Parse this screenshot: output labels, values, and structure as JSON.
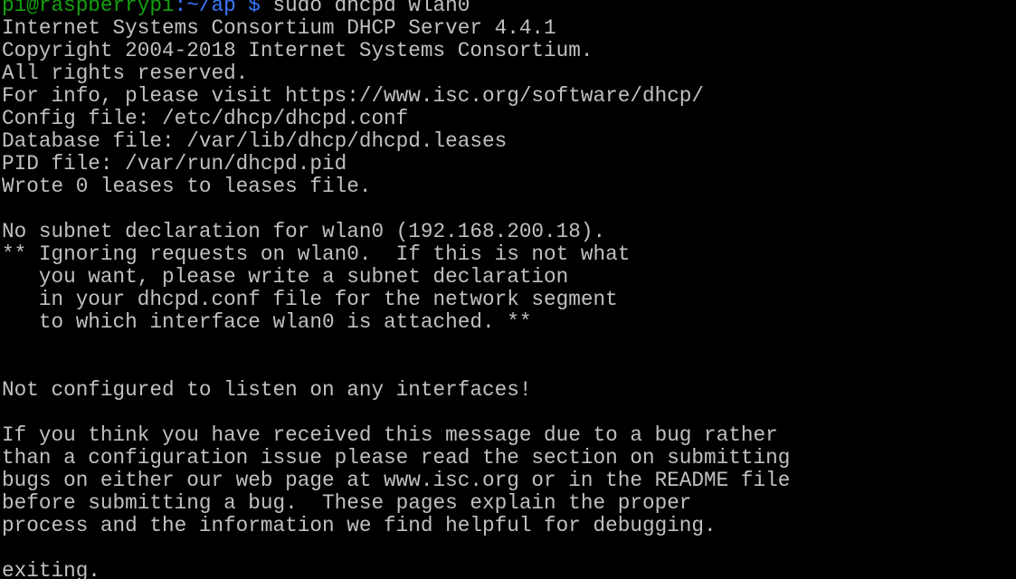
{
  "prompt": {
    "user_host": "pi@raspberrypi",
    "path": ":~/ap $",
    "command": " sudo dhcpd wlan0"
  },
  "output_lines": [
    "Internet Systems Consortium DHCP Server 4.4.1",
    "Copyright 2004-2018 Internet Systems Consortium.",
    "All rights reserved.",
    "For info, please visit https://www.isc.org/software/dhcp/",
    "Config file: /etc/dhcp/dhcpd.conf",
    "Database file: /var/lib/dhcp/dhcpd.leases",
    "PID file: /var/run/dhcpd.pid",
    "Wrote 0 leases to leases file.",
    "",
    "No subnet declaration for wlan0 (192.168.200.18).",
    "** Ignoring requests on wlan0.  If this is not what",
    "   you want, please write a subnet declaration",
    "   in your dhcpd.conf file for the network segment",
    "   to which interface wlan0 is attached. **",
    "",
    "",
    "Not configured to listen on any interfaces!",
    "",
    "If you think you have received this message due to a bug rather",
    "than a configuration issue please read the section on submitting",
    "bugs on either our web page at www.isc.org or in the README file",
    "before submitting a bug.  These pages explain the proper",
    "process and the information we find helpful for debugging.",
    "",
    "exiting."
  ],
  "colors": {
    "background": "#000000",
    "text": "#c0c0c0",
    "prompt_user": "#13a10e",
    "prompt_path": "#3b78ff"
  }
}
